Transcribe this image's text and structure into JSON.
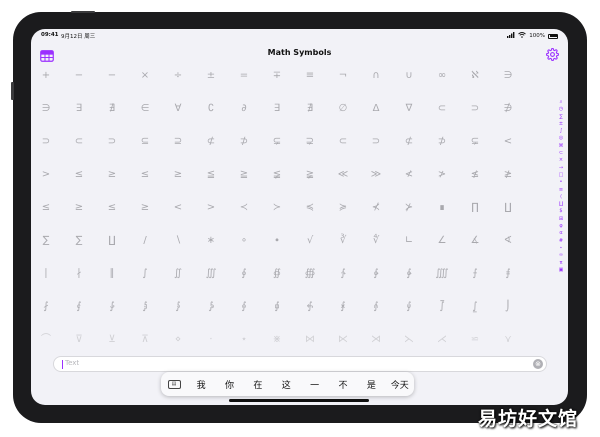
{
  "status_bar": {
    "time": "09:41",
    "date": "9月12日 周三",
    "battery": "100%"
  },
  "nav": {
    "title": "Math Symbols",
    "left_icon": "table-icon",
    "right_icon": "gear-icon"
  },
  "colors": {
    "accent": "#9b30ff",
    "symbol": "#a9a9ae",
    "background": "#f2f2f7"
  },
  "symbols": {
    "rows": [
      [
        "+",
        "−",
        "−",
        "×",
        "÷",
        "±",
        "=",
        "∓",
        "≡",
        "¬",
        "∩",
        "∪",
        "∞",
        "ℵ",
        "∋"
      ],
      [
        "∋",
        "∃",
        "∄",
        "∈",
        "∀",
        "∁",
        "∂",
        "∃",
        "∄",
        "∅",
        "Δ",
        "∇",
        "⊂",
        "⊃",
        "∌"
      ],
      [
        "⊃",
        "⊂",
        "⊃",
        "⊆",
        "⊇",
        "⊄",
        "⊅",
        "⊊",
        "⊋",
        "⊂",
        "⊃",
        "⊄",
        "⊅",
        "⊊",
        "<"
      ],
      [
        ">",
        "≤",
        "≥",
        "≤",
        "≥",
        "≦",
        "≧",
        "≨",
        "≩",
        "≪",
        "≫",
        "≮",
        "≯",
        "≰",
        "≱"
      ],
      [
        "≤",
        "≥",
        "≤",
        "≥",
        "<",
        ">",
        "≺",
        "≻",
        "≼",
        "≽",
        "⊀",
        "⊁",
        "∎",
        "∏",
        "∐"
      ],
      [
        "∑",
        "∑",
        "∐",
        "/",
        "∖",
        "∗",
        "∘",
        "∙",
        "√",
        "∛",
        "∜",
        "∟",
        "∠",
        "∡",
        "∢"
      ],
      [
        "∣",
        "∤",
        "∥",
        "∫",
        "∬",
        "∭",
        "∮",
        "∯",
        "∰",
        "∱",
        "∲",
        "∳",
        "⨌",
        "⨍",
        "⨎"
      ],
      [
        "⨏",
        "⨐",
        "⨑",
        "⨒",
        "⨓",
        "⨔",
        "⨕",
        "⨖",
        "⨗",
        "⨘",
        "⨙",
        "⨚",
        "⨛",
        "⨜",
        "⌡"
      ],
      [
        "⌒",
        "⊽",
        "⊻",
        "⊼",
        "⋄",
        "⋅",
        "⋆",
        "⋇",
        "⋈",
        "⋉",
        "⋊",
        "⋋",
        "⋌",
        "⋍",
        "⋎"
      ]
    ]
  },
  "index_bar": [
    {
      "icon": "search-icon",
      "glyph": "⌕"
    },
    {
      "icon": "clock-icon",
      "glyph": "◷"
    },
    {
      "icon": "sigma-icon",
      "glyph": "∑"
    },
    {
      "icon": "plus-minus-icon",
      "glyph": "±"
    },
    {
      "icon": "integral-icon",
      "glyph": "∫"
    },
    {
      "icon": "circle-icon",
      "glyph": "◎"
    },
    {
      "icon": "cross-icon",
      "glyph": "⌘"
    },
    {
      "icon": "subset-icon",
      "glyph": "⊂"
    },
    {
      "icon": "times-icon",
      "glyph": "×"
    },
    {
      "icon": "arrow-icon",
      "glyph": "→"
    },
    {
      "icon": "square-icon",
      "glyph": "□"
    },
    {
      "icon": "dot-icon",
      "glyph": "•"
    },
    {
      "icon": "equal-icon",
      "glyph": "≡"
    },
    {
      "icon": "bracket-icon",
      "glyph": "⟨"
    },
    {
      "icon": "sum-icon",
      "glyph": "∐"
    },
    {
      "icon": "dollar-icon",
      "glyph": "$"
    },
    {
      "icon": "grid-icon",
      "glyph": "⊞"
    },
    {
      "icon": "phi-icon",
      "glyph": "φ"
    },
    {
      "icon": "alpha-icon",
      "glyph": "α"
    },
    {
      "icon": "hash-icon",
      "glyph": "#"
    },
    {
      "icon": "star-icon",
      "glyph": "⋆"
    },
    {
      "icon": "infinity-icon",
      "glyph": "∞"
    },
    {
      "icon": "pi-icon",
      "glyph": "π"
    },
    {
      "icon": "box-icon",
      "glyph": "▣"
    }
  ],
  "search": {
    "placeholder": "Text"
  },
  "ime": {
    "candidates": [
      "我",
      "你",
      "在",
      "这",
      "一",
      "不",
      "是",
      "今天"
    ]
  },
  "watermark": "易坊好文馆"
}
